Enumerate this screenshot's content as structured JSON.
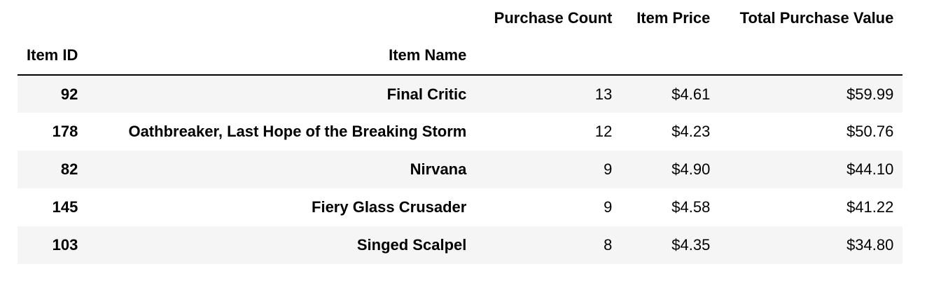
{
  "table": {
    "column_headers": [
      "Purchase Count",
      "Item Price",
      "Total Purchase Value"
    ],
    "index_headers": [
      "Item ID",
      "Item Name"
    ],
    "rows": [
      {
        "item_id": "92",
        "item_name": "Final Critic",
        "purchase_count": "13",
        "item_price": "$4.61",
        "total_purchase_value": "$59.99"
      },
      {
        "item_id": "178",
        "item_name": "Oathbreaker, Last Hope of the Breaking Storm",
        "purchase_count": "12",
        "item_price": "$4.23",
        "total_purchase_value": "$50.76"
      },
      {
        "item_id": "82",
        "item_name": "Nirvana",
        "purchase_count": "9",
        "item_price": "$4.90",
        "total_purchase_value": "$44.10"
      },
      {
        "item_id": "145",
        "item_name": "Fiery Glass Crusader",
        "purchase_count": "9",
        "item_price": "$4.58",
        "total_purchase_value": "$41.22"
      },
      {
        "item_id": "103",
        "item_name": "Singed Scalpel",
        "purchase_count": "8",
        "item_price": "$4.35",
        "total_purchase_value": "$34.80"
      }
    ]
  }
}
